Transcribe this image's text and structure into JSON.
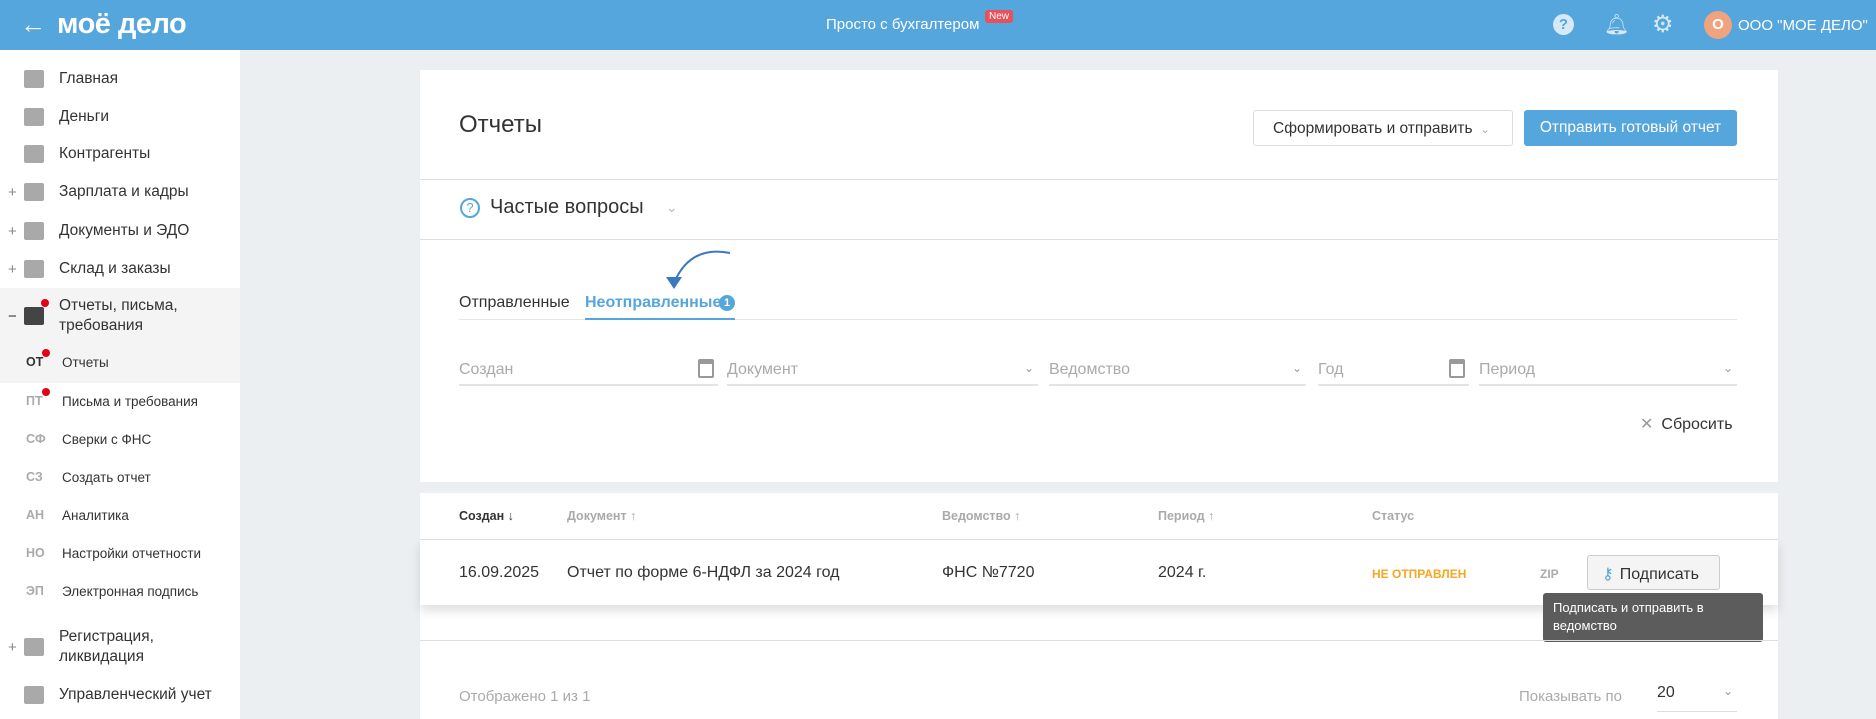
{
  "header": {
    "logo": "моё дело",
    "center_link": "Просто с бухгалтером",
    "new_badge": "New",
    "avatar_letter": "О",
    "org_name": "ООО \"МОЕ ДЕЛО\"",
    "icons": [
      "back-arrow-icon",
      "help-icon",
      "bell-icon",
      "gear-icon"
    ]
  },
  "sidebar": {
    "items": [
      {
        "label": "Главная",
        "expand": ""
      },
      {
        "label": "Деньги",
        "expand": ""
      },
      {
        "label": "Контрагенты",
        "expand": ""
      },
      {
        "label": "Зарплата и кадры",
        "expand": "+"
      },
      {
        "label": "Документы и ЭДО",
        "expand": "+"
      },
      {
        "label": "Склад и заказы",
        "expand": "+"
      },
      {
        "label": "Отчеты, письма, требования",
        "expand": "−"
      },
      {
        "label": "Регистрация, ликвидация",
        "expand": "+"
      },
      {
        "label": "Управленческий учет",
        "expand": ""
      }
    ],
    "subitems": [
      {
        "abbr": "ОТ",
        "label": "Отчеты"
      },
      {
        "abbr": "ПТ",
        "label": "Письма и требования"
      },
      {
        "abbr": "СФ",
        "label": "Сверки с ФНС"
      },
      {
        "abbr": "СЗ",
        "label": "Создать отчет"
      },
      {
        "abbr": "АН",
        "label": "Аналитика"
      },
      {
        "abbr": "НО",
        "label": "Настройки отчетности"
      },
      {
        "abbr": "ЭП",
        "label": "Электронная подпись"
      }
    ]
  },
  "page": {
    "title": "Отчеты",
    "btn_form": "Сформировать и отправить",
    "btn_send": "Отправить готовый отчет",
    "faq": "Частые вопросы"
  },
  "tabs": [
    {
      "label": "Отправленные"
    },
    {
      "label": "Неотправленные",
      "badge": "1"
    }
  ],
  "filters": {
    "created": "Создан",
    "document": "Документ",
    "agency": "Ведомство",
    "year": "Год",
    "period": "Период",
    "reset": "Сбросить"
  },
  "table": {
    "headers": [
      "Создан ↓",
      "Документ ↑",
      "Ведомство ↑",
      "Период ↑",
      "Статус"
    ],
    "rows": [
      {
        "created": "16.09.2025",
        "document": "Отчет по форме 6-НДФЛ за 2024 год",
        "agency": "ФНС №7720",
        "period": "2024 г.",
        "status": "НЕ ОТПРАВЛЕН",
        "zip": "ZIP",
        "sign": "Подписать"
      }
    ],
    "tooltip": "Подписать и отправить в ведомство",
    "shown": "Отображено 1 из 1",
    "per_page_label": "Показывать по",
    "per_page": "20"
  },
  "colors": {
    "accent": "#55a6dc",
    "status": "#f5a623",
    "badge_red": "#e30016"
  }
}
